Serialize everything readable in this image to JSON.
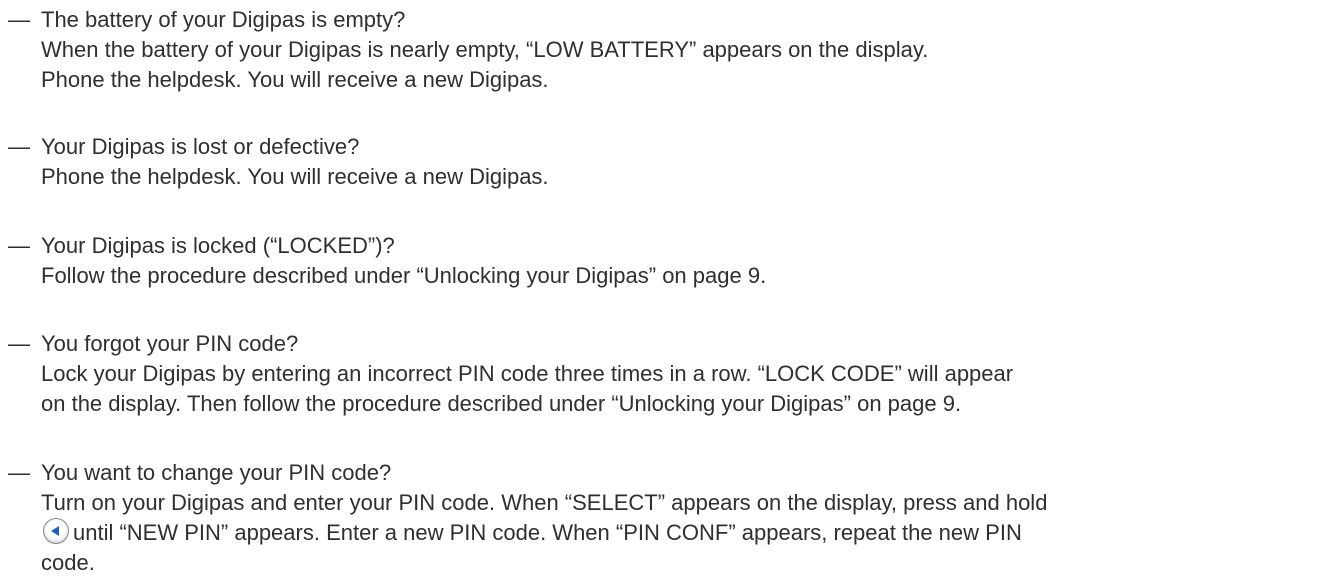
{
  "items": [
    {
      "dash": "—",
      "question": "The battery of your Digipas is empty?",
      "answer_lines": [
        "When the battery of your Digipas is nearly empty, “LOW BATTERY” appears on the display.",
        "Phone the helpdesk. You will receive a new Digipas."
      ]
    },
    {
      "dash": "—",
      "question": "Your Digipas is lost or defective?",
      "answer_lines": [
        "Phone the helpdesk. You will receive a new Digipas."
      ]
    },
    {
      "dash": "—",
      "question": "Your Digipas is locked (“LOCKED”)?",
      "answer_lines": [
        "Follow the procedure described under “Unlocking your Digipas” on page 9."
      ]
    },
    {
      "dash": "—",
      "question": "You forgot your PIN code?",
      "answer_lines": [
        "Lock your Digipas by entering an incorrect PIN code three times in a row. “LOCK CODE” will appear",
        "on the display. Then follow the procedure described under “Unlocking your Digipas” on page 9."
      ]
    },
    {
      "dash": "—",
      "question": "You want to change your PIN code?",
      "answer_line_1": "Turn on your Digipas and enter your PIN code. When “SELECT” appears on the display, press and hold",
      "answer_line_2_after_icon": "until “NEW PIN” appears. Enter a new PIN code. When “PIN CONF” appears, repeat  the new PIN",
      "answer_line_3": "code.",
      "icon": "left-arrow-button-icon"
    }
  ],
  "colors": {
    "text": "#2f2f2f",
    "arrow": "#1f5fc8"
  }
}
